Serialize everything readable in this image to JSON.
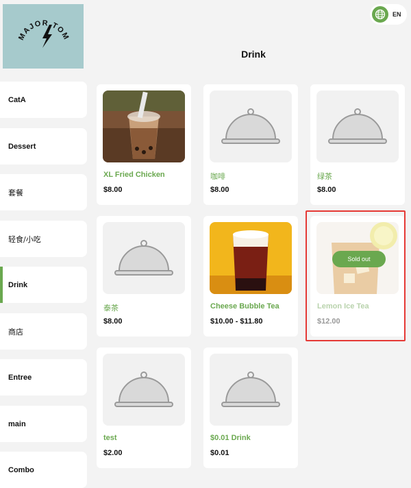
{
  "header": {
    "logo_text": "MAJOR TOM",
    "page_title": "Drink",
    "language": "EN"
  },
  "sidebar": {
    "items": [
      {
        "label": "CatA"
      },
      {
        "label": "Dessert"
      },
      {
        "label": "套餐"
      },
      {
        "label": "轻食/小吃"
      },
      {
        "label": "Drink",
        "active": true
      },
      {
        "label": "商店"
      },
      {
        "label": "Entree"
      },
      {
        "label": "main"
      },
      {
        "label": "Combo"
      }
    ]
  },
  "products": [
    {
      "name": "XL Fried Chicken",
      "price": "$8.00",
      "image": "bubble-tea-photo"
    },
    {
      "name": "咖啡",
      "price": "$8.00",
      "image": "cloche-placeholder"
    },
    {
      "name": "绿茶",
      "price": "$8.00",
      "image": "cloche-placeholder"
    },
    {
      "name": "泰茶",
      "price": "$8.00",
      "image": "cloche-placeholder"
    },
    {
      "name": "Cheese Bubble Tea",
      "price": "$10.00 - $11.80",
      "image": "cheese-tea-photo"
    },
    {
      "name": "Lemon Ice Tea",
      "price": "$12.00",
      "image": "lemon-tea-photo",
      "badge": "Sold out"
    },
    {
      "name": "test",
      "price": "$2.00",
      "image": "cloche-placeholder"
    },
    {
      "name": "$0.01 Drink",
      "price": "$0.01",
      "image": "cloche-placeholder"
    }
  ],
  "colors": {
    "accent": "#6aa84f",
    "highlight": "#e53935",
    "logo_bg": "#a6cacc"
  }
}
